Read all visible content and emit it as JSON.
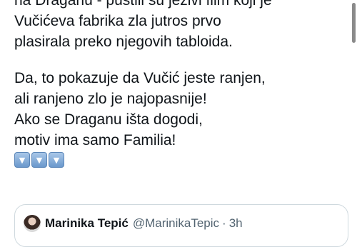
{
  "tweet": {
    "lines_a": [
      "na Draganu - pustili su jezivi film koji je",
      "Vučićeva fabrika zla jutros prvo",
      "plasirala preko njegovih tabloida."
    ],
    "lines_b": [
      "Da, to pokazuje da Vučić jeste ranjen,",
      "ali ranjeno zlo je najopasnije!",
      "Ako se Draganu išta dogodi,",
      "motiv ima samo Familia!"
    ],
    "emojis": [
      "▼",
      "▼",
      "▼"
    ],
    "emoji_icon": "down-arrow-emoji"
  },
  "quoted_tweet": {
    "name": "Marinika Tepić",
    "handle": "@MarinikaTepic",
    "separator": "·",
    "time": "3h"
  }
}
